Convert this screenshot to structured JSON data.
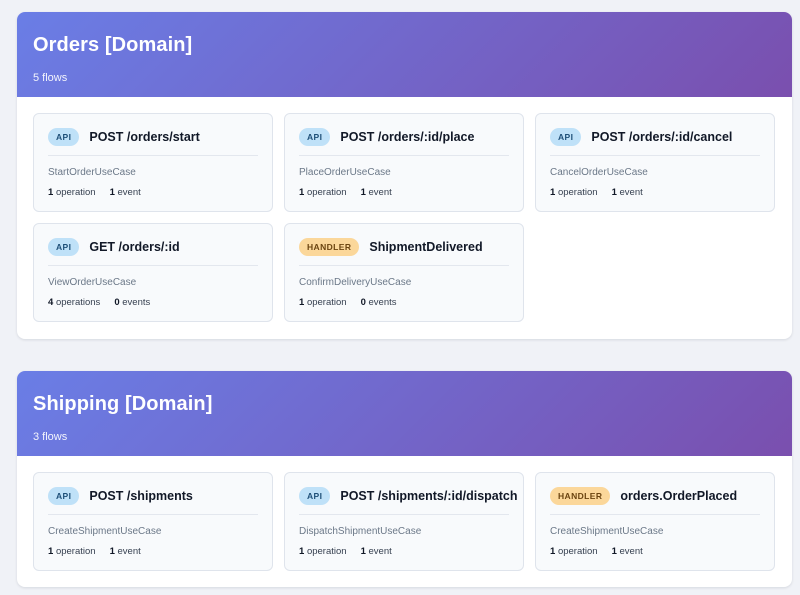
{
  "domains": [
    {
      "title": "Orders [Domain]",
      "count": "5 flows",
      "flows": [
        {
          "type": "API",
          "title": "POST /orders/start",
          "usecase": "StartOrderUseCase",
          "operations_n": "1",
          "operations_label": "operation",
          "events_n": "1",
          "events_label": "event"
        },
        {
          "type": "API",
          "title": "POST /orders/:id/place",
          "usecase": "PlaceOrderUseCase",
          "operations_n": "1",
          "operations_label": "operation",
          "events_n": "1",
          "events_label": "event"
        },
        {
          "type": "API",
          "title": "POST /orders/:id/cancel",
          "usecase": "CancelOrderUseCase",
          "operations_n": "1",
          "operations_label": "operation",
          "events_n": "1",
          "events_label": "event"
        },
        {
          "type": "API",
          "title": "GET /orders/:id",
          "usecase": "ViewOrderUseCase",
          "operations_n": "4",
          "operations_label": "operations",
          "events_n": "0",
          "events_label": "events"
        },
        {
          "type": "HANDLER",
          "title": "ShipmentDelivered",
          "usecase": "ConfirmDeliveryUseCase",
          "operations_n": "1",
          "operations_label": "operation",
          "events_n": "0",
          "events_label": "events"
        }
      ]
    },
    {
      "title": "Shipping [Domain]",
      "count": "3 flows",
      "flows": [
        {
          "type": "API",
          "title": "POST /shipments",
          "usecase": "CreateShipmentUseCase",
          "operations_n": "1",
          "operations_label": "operation",
          "events_n": "1",
          "events_label": "event"
        },
        {
          "type": "API",
          "title": "POST /shipments/:id/dispatch",
          "usecase": "DispatchShipmentUseCase",
          "operations_n": "1",
          "operations_label": "operation",
          "events_n": "1",
          "events_label": "event"
        },
        {
          "type": "HANDLER",
          "title": "orders.OrderPlaced",
          "usecase": "CreateShipmentUseCase",
          "operations_n": "1",
          "operations_label": "operation",
          "events_n": "1",
          "events_label": "event"
        }
      ]
    }
  ],
  "colors": {
    "header_gradient_start": "#6a7ee6",
    "header_gradient_end": "#7a4fae",
    "api_badge": "#bfe1f8",
    "handler_badge": "#fbd79a"
  }
}
